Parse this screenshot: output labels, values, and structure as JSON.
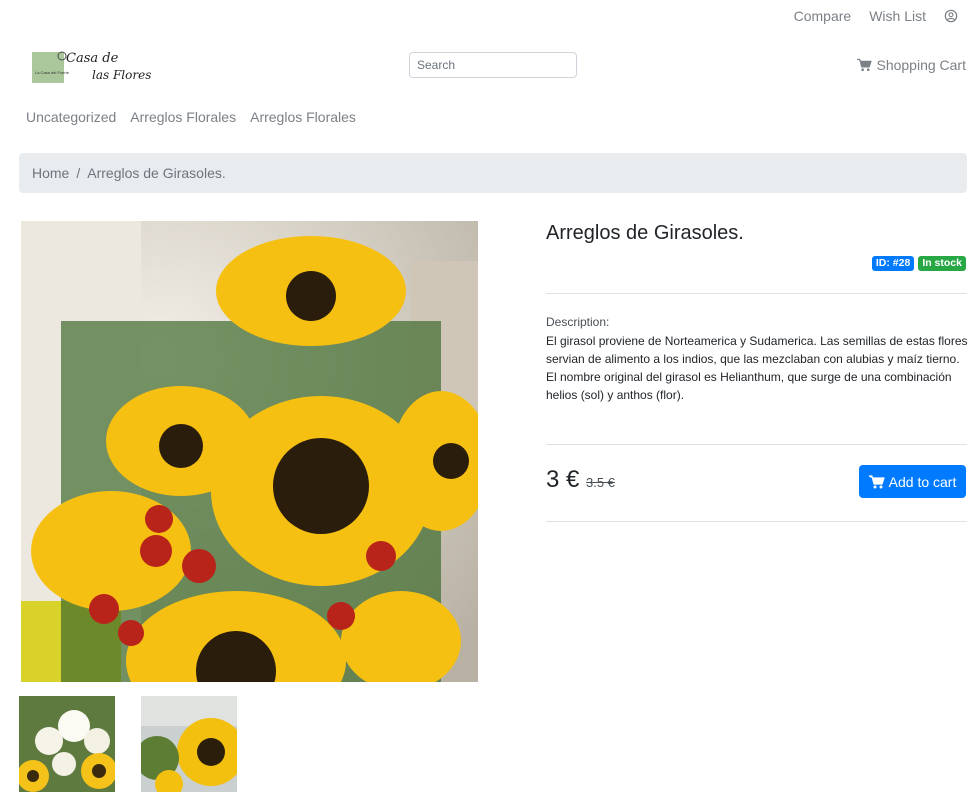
{
  "topbar": {
    "compare": "Compare",
    "wishlist": "Wish List",
    "user_icon": "user-circle-icon"
  },
  "header": {
    "logo_text_line1": "Casa de",
    "logo_text_line2": "las Flores",
    "logo_badge_text": "La Casa del Fuerte",
    "search_placeholder": "Search",
    "cart_label": "Shopping Cart",
    "cart_icon": "shopping-cart-icon"
  },
  "nav": {
    "items": [
      {
        "label": "Uncategorized"
      },
      {
        "label": "Arreglos Florales"
      },
      {
        "label": "Arreglos Florales"
      }
    ]
  },
  "breadcrumb": {
    "home": "Home",
    "separator": "/",
    "current": "Arreglos de Girasoles."
  },
  "product": {
    "title": "Arreglos de Girasoles.",
    "id_badge": "ID: #28",
    "stock_badge": "In stock",
    "description_label": "Description:",
    "description": "El girasol proviene de Norteamerica y Sudamerica. Las semillas de estas flores servian de alimento a los indios, que las mezclaban con alubias y maíz tierno. El nombre original del girasol es Helianthum, que surge de una combinación helios (sol) y anthos (flor).",
    "price": "3 €",
    "old_price": "3.5 €",
    "add_to_cart": "Add to cart"
  },
  "colors": {
    "primary": "#007bff",
    "success": "#28a745",
    "breadcrumb_bg": "#e9ecef",
    "muted_link": "#7b8187"
  }
}
